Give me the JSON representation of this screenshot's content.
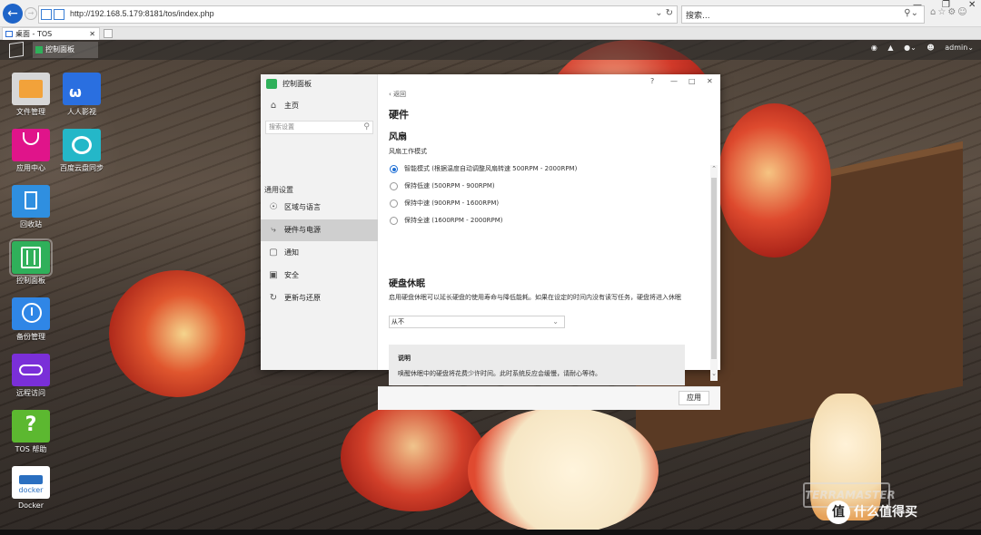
{
  "browser": {
    "url": "http://192.168.5.179:8181/tos/index.php",
    "search_placeholder": "搜索...",
    "tab_title": "桌面 - TOS"
  },
  "tos_bar": {
    "task_label": "控制面板",
    "user": "admin"
  },
  "desktop_icons": [
    {
      "label": "文件管理",
      "color": "#f2a23a"
    },
    {
      "label": "人人影视",
      "color": "#2a6fe0"
    },
    {
      "label": "应用中心",
      "color": "#e0148a"
    },
    {
      "label": "百度云盘同步",
      "color": "#24b7c8"
    },
    {
      "label": "回收站",
      "color": "#2f8fe0"
    },
    {
      "label": "控制面板",
      "color": "#2fb05a"
    },
    {
      "label": "备份管理",
      "color": "#2f86e6"
    },
    {
      "label": "远程访问",
      "color": "#7a2fd8"
    },
    {
      "label": "TOS 帮助",
      "color": "#5cb830"
    },
    {
      "label": "Docker",
      "color": "#2a6fc0"
    }
  ],
  "control_panel": {
    "title": "控制面板",
    "home": "主页",
    "search_placeholder": "搜索设置",
    "section_heading": "通用设置",
    "nav": [
      {
        "label": "区域与语言",
        "icon": "globe-icon"
      },
      {
        "label": "硬件与电源",
        "icon": "wrench-icon"
      },
      {
        "label": "通知",
        "icon": "chat-icon"
      },
      {
        "label": "安全",
        "icon": "lock-icon"
      },
      {
        "label": "更新与还原",
        "icon": "sync-icon"
      }
    ],
    "back": "返回",
    "page_title": "硬件",
    "fan": {
      "heading": "风扇",
      "mode_label": "风扇工作模式",
      "options": [
        "智能模式 (根据温度自动调整风扇转速 500RPM - 2000RPM)",
        "保持低速 (500RPM - 900RPM)",
        "保持中速 (900RPM - 1600RPM)",
        "保持全速 (1600RPM - 2000RPM)"
      ],
      "selected_index": 0
    },
    "hibernate": {
      "heading": "硬盘休眠",
      "description": "启用硬盘休眠可以延长硬盘的使用寿命与降低能耗。如果在设定的时间内没有读写任务，硬盘将进入休眠",
      "value": "从不"
    },
    "note": {
      "title": "说明",
      "text": "唤醒休眠中的硬盘将花费少许时间。此时系统反应会缓慢，请耐心等待。"
    },
    "apply": "应用",
    "help": "?"
  },
  "watermark": {
    "brand": "TERRAMASTER",
    "site": "什么值得买",
    "badge": "值"
  }
}
